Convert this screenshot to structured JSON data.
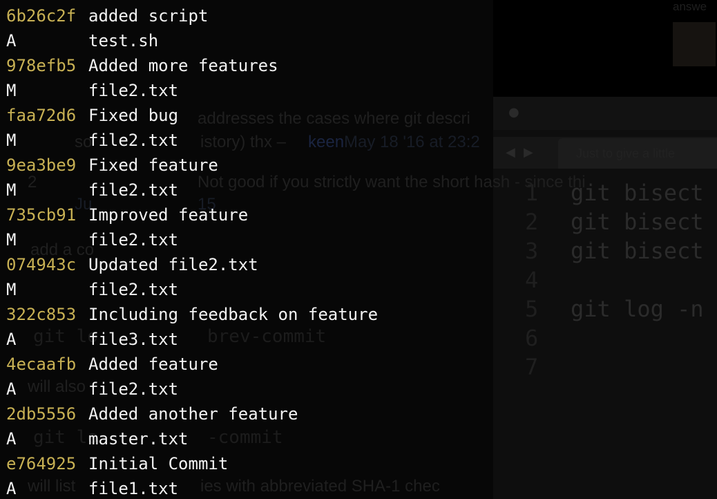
{
  "window": {
    "title": ""
  },
  "colors": {
    "background": "#000000",
    "commit_hash": "#c8b154",
    "text": "#f2f2f2"
  },
  "terminal": {
    "entries": [
      {
        "hash": "6b26c2f",
        "message": "added script",
        "status": "A",
        "file": "test.sh"
      },
      {
        "hash": "978efb5",
        "message": "Added more features",
        "status": "M",
        "file": "file2.txt"
      },
      {
        "hash": "faa72d6",
        "message": "Fixed bug",
        "status": "M",
        "file": "file2.txt"
      },
      {
        "hash": "9ea3be9",
        "message": "Fixed feature",
        "status": "M",
        "file": "file2.txt"
      },
      {
        "hash": "735cb91",
        "message": "Improved feature",
        "status": "M",
        "file": "file2.txt"
      },
      {
        "hash": "074943c",
        "message": "Updated file2.txt",
        "status": "M",
        "file": "file2.txt"
      },
      {
        "hash": "322c853",
        "message": "Including feedback on feature",
        "status": "A",
        "file": "file3.txt"
      },
      {
        "hash": "4ecaafb",
        "message": "Added feature",
        "status": "A",
        "file": "file2.txt"
      },
      {
        "hash": "2db5556",
        "message": "Added another feature",
        "status": "A",
        "file": "master.txt"
      },
      {
        "hash": "e764925",
        "message": "Initial Commit",
        "status": "A",
        "file": "file1.txt"
      }
    ]
  },
  "background_page": {
    "top_right_text": "answe",
    "comment_line1": "addresses the cases where git descri",
    "comment_line2_start": "so",
    "comment_line2_mid": "istory) thx –",
    "comment_user": "keen",
    "comment_time": "May 18 '16 at 23:2",
    "vote_count": "2",
    "comment2_text": "Not good if you strictly want the short hash - since thi",
    "comment2_time": "Ju",
    "comment2_time_end": "15",
    "add_comment": "add a co",
    "code1": "git lo",
    "code1_end": "brev-commit",
    "will_also": "will also",
    "code2": "git lo",
    "code2_end": "-commit",
    "will_list": "will list",
    "will_list_end": "ies with abbreviated SHA-1 chec",
    "editor_tab": "Just to give a little",
    "editor_lines": [
      {
        "num": "1",
        "code": "git bisect"
      },
      {
        "num": "2",
        "code": "git bisect"
      },
      {
        "num": "3",
        "code": "git bisect"
      },
      {
        "num": "4",
        "code": ""
      },
      {
        "num": "5",
        "code": "git log -n"
      },
      {
        "num": "6",
        "code": ""
      },
      {
        "num": "7",
        "code": ""
      }
    ]
  }
}
